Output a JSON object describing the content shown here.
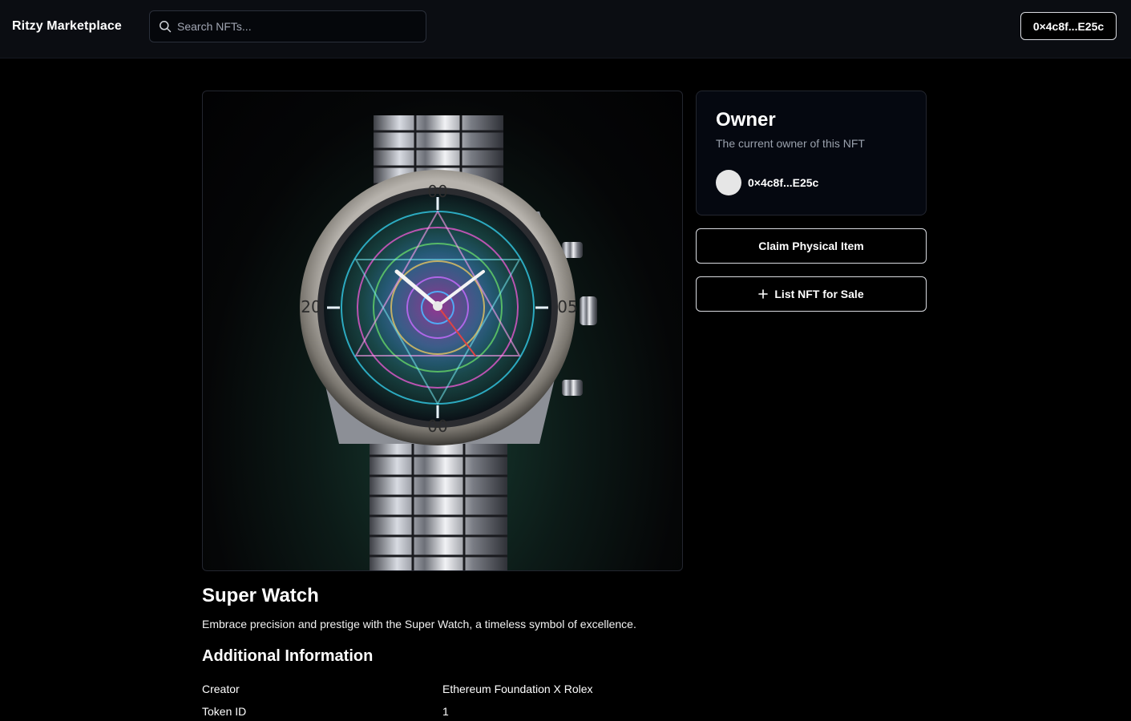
{
  "header": {
    "brand": "Ritzy Marketplace",
    "search_placeholder": "Search NFTs...",
    "wallet_label": "0×4c8f...E25c"
  },
  "nft": {
    "image_icon": "watch-image",
    "name": "Super Watch",
    "description": "Embrace precision and prestige with the Super Watch, a timeless symbol of excellence."
  },
  "owner": {
    "title": "Owner",
    "subtitle": "The current owner of this NFT",
    "address": "0×4c8f...E25c"
  },
  "actions": {
    "claim_label": "Claim Physical Item",
    "list_label": "List NFT for Sale",
    "list_icon": "plus-icon"
  },
  "info": {
    "title": "Additional Information",
    "rows": [
      {
        "key": "Creator",
        "value": "Ethereum Foundation X Rolex"
      },
      {
        "key": "Token ID",
        "value": "1"
      }
    ]
  },
  "colors": {
    "background": "#000000",
    "header_bg": "#0b0d12",
    "card_bg": "#050810",
    "muted_text": "#9aa1ad",
    "border": "#d9dbe0"
  }
}
